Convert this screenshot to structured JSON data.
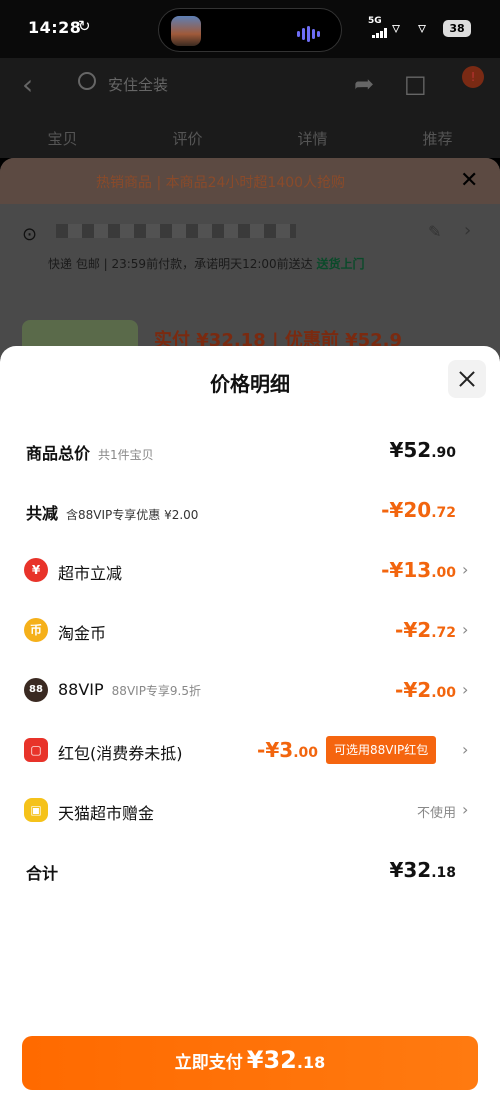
{
  "status_bar": {
    "time": "14:28",
    "network": "5G",
    "battery": "38"
  },
  "background": {
    "search_placeholder": "安住全装",
    "tabs": [
      "宝贝",
      "评价",
      "详情",
      "推荐"
    ],
    "banner": "热销商品 | 本商品24小时超1400人抢购",
    "delivery_text": "快递 包邮 | 23:59前付款，承诺明天12:00前送达",
    "delivery_highlight": "送货上门",
    "price_text": "实付 ¥32.18 | 优惠前 ¥52.9"
  },
  "modal": {
    "title": "价格明细",
    "rows": [
      {
        "label": "商品总价",
        "sub": "共1件宝贝",
        "value": "¥52",
        "decimal": ".90"
      },
      {
        "label": "共减",
        "sub": "含88VIP专享优惠 ¥2.00",
        "value": "-¥20",
        "decimal": ".72"
      },
      {
        "label": "超市立减",
        "value": "-¥13",
        "decimal": ".00",
        "icon": "yen-coupon-icon"
      },
      {
        "label": "淘金币",
        "value": "-¥2",
        "decimal": ".72",
        "icon": "gold-coin-icon"
      },
      {
        "label": "88VIP",
        "sub": "88VIP专享9.5折",
        "value": "-¥2",
        "decimal": ".00",
        "icon": "vip-88-icon"
      },
      {
        "label": "红包(消费券未抵)",
        "value": "-¥3",
        "decimal": ".00",
        "promo": "可选用88VIP红包",
        "icon": "red-packet-icon"
      },
      {
        "label": "天猫超市赠金",
        "muted": "不使用",
        "icon": "gift-cat-icon"
      },
      {
        "label": "合计",
        "value": "¥32",
        "decimal": ".18"
      }
    ],
    "pay_label": "立即支付",
    "pay_amount": "¥32",
    "pay_decimal": ".18"
  },
  "colors": {
    "accent": "#f5650f",
    "coupon_red": "#e8332a",
    "coin_gold": "#f5b01a",
    "vip_dark": "#3a2a22",
    "gift_yellow": "#f5c21a"
  }
}
